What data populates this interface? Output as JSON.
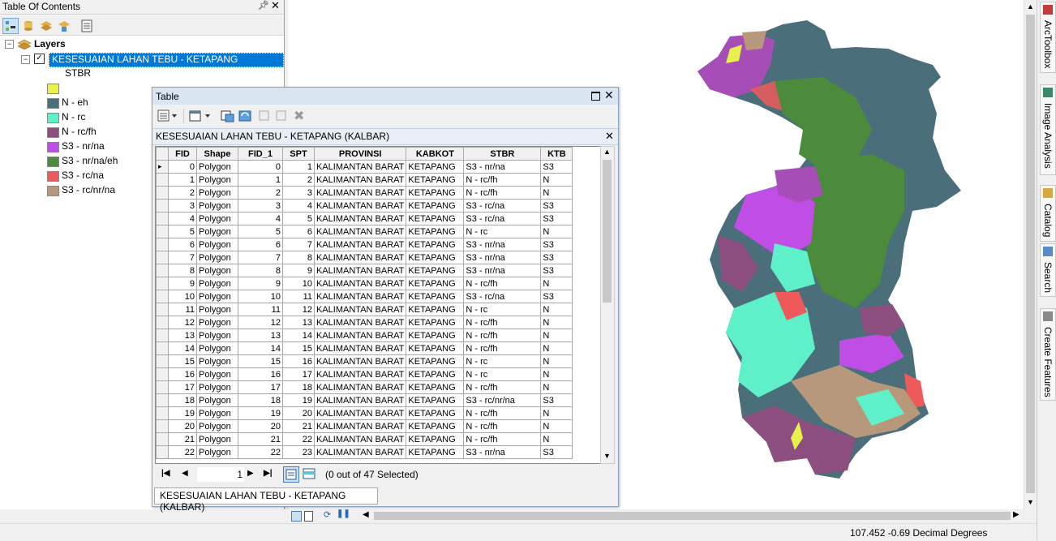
{
  "toc": {
    "title": "Table Of Contents",
    "layers_label": "Layers",
    "layer_name": "KESESUAIAN LAHAN TEBU - KETAPANG (KALBAR)",
    "field_name": "STBR",
    "legend": [
      {
        "label": "",
        "color": "#e8f04a"
      },
      {
        "label": "N - eh",
        "color": "#4a6f7a"
      },
      {
        "label": "N - rc",
        "color": "#5ef0c8"
      },
      {
        "label": "N - rc/fh",
        "color": "#8c4f7f"
      },
      {
        "label": "S3 - nr/na",
        "color": "#c04de6"
      },
      {
        "label": "S3 - nr/na/eh",
        "color": "#4c8a3c"
      },
      {
        "label": "S3 - rc/na",
        "color": "#ee5a5a"
      },
      {
        "label": "S3 - rc/nr/na",
        "color": "#b8987a"
      }
    ]
  },
  "table": {
    "window_title": "Table",
    "subtitle": "KESESUAIAN LAHAN TEBU - KETAPANG (KALBAR)",
    "columns": [
      "FID",
      "Shape",
      "FID_1",
      "SPT",
      "PROVINSI",
      "KABKOT",
      "STBR",
      "KTB"
    ],
    "rows": [
      [
        "0",
        "Polygon",
        "0",
        "1",
        "KALIMANTAN BARAT",
        "KETAPANG",
        "S3 - nr/na",
        "S3"
      ],
      [
        "1",
        "Polygon",
        "1",
        "2",
        "KALIMANTAN BARAT",
        "KETAPANG",
        "N - rc/fh",
        "N"
      ],
      [
        "2",
        "Polygon",
        "2",
        "3",
        "KALIMANTAN BARAT",
        "KETAPANG",
        "N - rc/fh",
        "N"
      ],
      [
        "3",
        "Polygon",
        "3",
        "4",
        "KALIMANTAN BARAT",
        "KETAPANG",
        "S3 - rc/na",
        "S3"
      ],
      [
        "4",
        "Polygon",
        "4",
        "5",
        "KALIMANTAN BARAT",
        "KETAPANG",
        "S3 - rc/na",
        "S3"
      ],
      [
        "5",
        "Polygon",
        "5",
        "6",
        "KALIMANTAN BARAT",
        "KETAPANG",
        "N - rc",
        "N"
      ],
      [
        "6",
        "Polygon",
        "6",
        "7",
        "KALIMANTAN BARAT",
        "KETAPANG",
        "S3 - nr/na",
        "S3"
      ],
      [
        "7",
        "Polygon",
        "7",
        "8",
        "KALIMANTAN BARAT",
        "KETAPANG",
        "S3 - nr/na",
        "S3"
      ],
      [
        "8",
        "Polygon",
        "8",
        "9",
        "KALIMANTAN BARAT",
        "KETAPANG",
        "S3 - nr/na",
        "S3"
      ],
      [
        "9",
        "Polygon",
        "9",
        "10",
        "KALIMANTAN BARAT",
        "KETAPANG",
        "N - rc/fh",
        "N"
      ],
      [
        "10",
        "Polygon",
        "10",
        "11",
        "KALIMANTAN BARAT",
        "KETAPANG",
        "S3 - rc/na",
        "S3"
      ],
      [
        "11",
        "Polygon",
        "11",
        "12",
        "KALIMANTAN BARAT",
        "KETAPANG",
        "N - rc",
        "N"
      ],
      [
        "12",
        "Polygon",
        "12",
        "13",
        "KALIMANTAN BARAT",
        "KETAPANG",
        "N - rc/fh",
        "N"
      ],
      [
        "13",
        "Polygon",
        "13",
        "14",
        "KALIMANTAN BARAT",
        "KETAPANG",
        "N - rc/fh",
        "N"
      ],
      [
        "14",
        "Polygon",
        "14",
        "15",
        "KALIMANTAN BARAT",
        "KETAPANG",
        "N - rc/fh",
        "N"
      ],
      [
        "15",
        "Polygon",
        "15",
        "16",
        "KALIMANTAN BARAT",
        "KETAPANG",
        "N - rc",
        "N"
      ],
      [
        "16",
        "Polygon",
        "16",
        "17",
        "KALIMANTAN BARAT",
        "KETAPANG",
        "N - rc",
        "N"
      ],
      [
        "17",
        "Polygon",
        "17",
        "18",
        "KALIMANTAN BARAT",
        "KETAPANG",
        "N - rc/fh",
        "N"
      ],
      [
        "18",
        "Polygon",
        "18",
        "19",
        "KALIMANTAN BARAT",
        "KETAPANG",
        "S3 - rc/nr/na",
        "S3"
      ],
      [
        "19",
        "Polygon",
        "19",
        "20",
        "KALIMANTAN BARAT",
        "KETAPANG",
        "N - rc/fh",
        "N"
      ],
      [
        "20",
        "Polygon",
        "20",
        "21",
        "KALIMANTAN BARAT",
        "KETAPANG",
        "N - rc/fh",
        "N"
      ],
      [
        "21",
        "Polygon",
        "21",
        "22",
        "KALIMANTAN BARAT",
        "KETAPANG",
        "N - rc/fh",
        "N"
      ],
      [
        "22",
        "Polygon",
        "22",
        "23",
        "KALIMANTAN BARAT",
        "KETAPANG",
        "S3 - nr/na",
        "S3"
      ]
    ],
    "current_record": "1",
    "selection_text": "(0 out of 47 Selected)",
    "bottom_tab": "KESESUAIAN LAHAN TEBU - KETAPANG (KALBAR)"
  },
  "right_tabs": [
    "ArcToolbox",
    "Image Analysis",
    "Catalog",
    "Search",
    "Create Features"
  ],
  "status": {
    "coords": "107.452  -0.69 Decimal Degrees"
  }
}
